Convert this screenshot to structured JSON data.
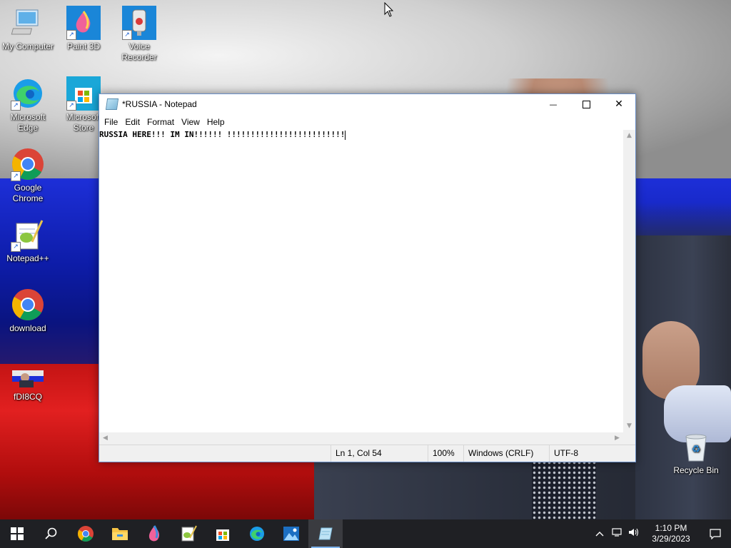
{
  "desktop": {
    "icons": [
      {
        "label": "My Computer",
        "icon": "computer-icon"
      },
      {
        "label": "Paint 3D",
        "icon": "paint3d-icon"
      },
      {
        "label": "Voice Recorder",
        "icon": "voice-recorder-icon"
      },
      {
        "label": "Microsoft Edge",
        "icon": "edge-icon"
      },
      {
        "label": "Microsoft Store",
        "icon": "store-icon"
      },
      {
        "label": "Google Chrome",
        "icon": "chrome-icon"
      },
      {
        "label": "Notepad++",
        "icon": "notepadpp-icon"
      },
      {
        "label": "download",
        "icon": "chrome-icon"
      },
      {
        "label": "fDI8CQ",
        "icon": "image-thumbnail-icon"
      },
      {
        "label": "Recycle Bin",
        "icon": "recycle-bin-icon"
      }
    ]
  },
  "notepad": {
    "title": "*RUSSIA - Notepad",
    "menu": [
      "File",
      "Edit",
      "Format",
      "View",
      "Help"
    ],
    "content": "RUSSIA HERE!!! IM IN!!!!!! !!!!!!!!!!!!!!!!!!!!!!!!!",
    "status": {
      "position": "Ln 1, Col 54",
      "zoom": "100%",
      "line_endings": "Windows (CRLF)",
      "encoding": "UTF-8"
    },
    "controls": {
      "minimize": "—",
      "maximize": "☐",
      "close": "✕"
    }
  },
  "taskbar": {
    "apps": [
      "start",
      "search",
      "chrome",
      "file-explorer",
      "paint3d",
      "notepadpp",
      "store",
      "edge",
      "photos",
      "notepad"
    ],
    "clock": {
      "time": "1:10 PM",
      "date": "3/29/2023"
    }
  },
  "colors": {
    "taskbar": "#1f2024",
    "accent": "#7fb4ee",
    "flag_blue": "#1d2fd8",
    "flag_red": "#d41a1a"
  }
}
